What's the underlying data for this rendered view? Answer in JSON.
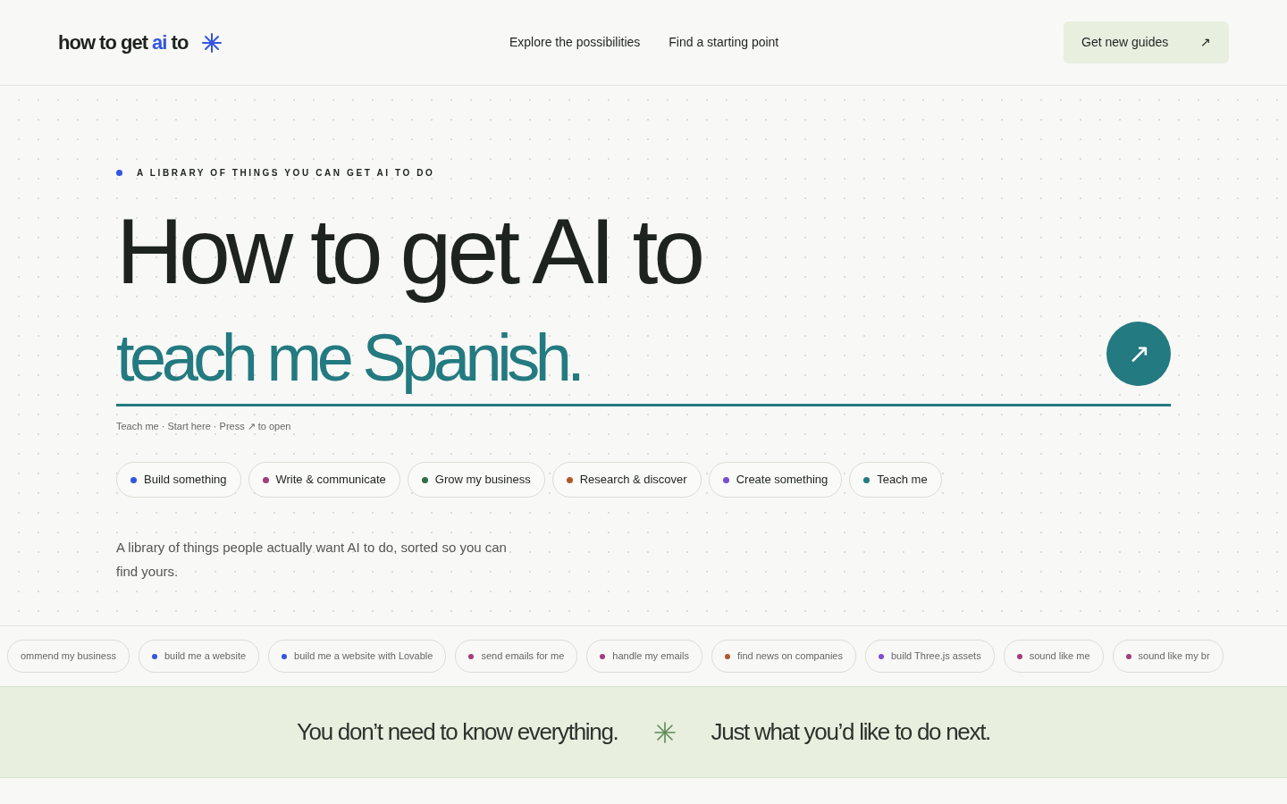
{
  "header": {
    "logo": [
      {
        "text": "how to get",
        "accent": false
      },
      {
        "text": "ai",
        "accent": true
      },
      {
        "text": "to",
        "accent": false
      }
    ],
    "nav": [
      "Explore the possibilities",
      "Find a starting point"
    ],
    "cta": {
      "label": "Get new guides",
      "icon": "↗"
    }
  },
  "hero": {
    "eyebrow": "A LIBRARY OF THINGS YOU CAN GET AI TO DO",
    "title": "How to get AI to",
    "phrase": "teach me Spanish.",
    "go_icon": "↗",
    "hint": "Teach me · Start here · Press ↗ to open",
    "categories": [
      {
        "label": "Build something",
        "color": "#3355e0"
      },
      {
        "label": "Write & communicate",
        "color": "#a33d7d"
      },
      {
        "label": "Grow my business",
        "color": "#2f6e4a"
      },
      {
        "label": "Research & discover",
        "color": "#b0582a"
      },
      {
        "label": "Create something",
        "color": "#7a4fcf"
      },
      {
        "label": "Teach me",
        "color": "#237a80"
      }
    ],
    "description": "A library of things people actually want AI to do, sorted so you can find yours."
  },
  "ticker": [
    {
      "label": "ommend my business"
    },
    {
      "label": "build me a website",
      "color": "#3355e0"
    },
    {
      "label": "build me a website with Lovable",
      "color": "#3355e0"
    },
    {
      "label": "send emails for me",
      "color": "#a33d7d"
    },
    {
      "label": "handle my emails",
      "color": "#a33d7d"
    },
    {
      "label": "find news on companies",
      "color": "#b0582a"
    },
    {
      "label": "build Three.js assets",
      "color": "#7a4fcf"
    },
    {
      "label": "sound like me",
      "color": "#a33d7d"
    },
    {
      "label": "sound like my br",
      "color": "#a33d7d"
    }
  ],
  "banner": [
    "You don’t need to know everything.",
    "Just what you’d like to do next."
  ]
}
